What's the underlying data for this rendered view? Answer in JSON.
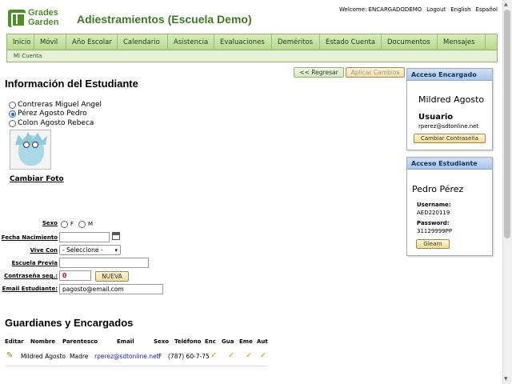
{
  "header": {
    "logo_line1": "Grades",
    "logo_line2": "Garden",
    "title": "Adiestramientos (Escuela Demo)",
    "welcome": "Welcome: ENCARGADODEMO",
    "logout": "Logout",
    "english": "English",
    "espanol": "Español"
  },
  "nav": {
    "items": [
      "Inicio",
      "Móvil",
      "Año Escolar",
      "Calendario",
      "Asistencia",
      "Evaluaciones",
      "Deméritos",
      "Estado Cuenta",
      "Documentos",
      "Mensajes"
    ],
    "sub": "Mi Cuenta"
  },
  "main": {
    "section_title": "Información del Estudiante",
    "back_button": "<< Regresar",
    "apply_button": "Aplicar Cambios",
    "students": [
      {
        "name": "Contreras Miguel Angel",
        "selected": false
      },
      {
        "name": "Pérez Agosto Pedro",
        "selected": true
      },
      {
        "name": "Colon Agosto Rebeca",
        "selected": false
      }
    ],
    "change_photo": "Cambiar Foto"
  },
  "form": {
    "sexo_label": "Sexo",
    "sexo_f": "F",
    "sexo_m": "M",
    "fecha_label": "Fecha Nacimiento",
    "fecha_value": "",
    "vive_label": "Vive Con",
    "vive_value": "- Seleccione -",
    "escuela_label": "Escuela Previa",
    "escuela_value": "",
    "pass_label": "Contraseña seg.:",
    "pass_value": "0",
    "pass_button": "NUEVA",
    "email_label": "Email Estudiante:",
    "email_value": "pagosto@email.com"
  },
  "guardians": {
    "title": "Guardianes y Encargados",
    "headers": [
      "Editar",
      "Nombre",
      "Parentesco",
      "Email",
      "Sexo",
      "Teléfono",
      "Enc",
      "Gua",
      "Eme",
      "Aut"
    ],
    "row": {
      "name": "Mildred Agosto",
      "relation": "Madre",
      "email": "rperez@sdtonline.net",
      "sex": "F",
      "phone": "(787) 60-7-75"
    }
  },
  "panel_guardian": {
    "title": "Acceso Encargado",
    "name": "Mildred Agosto",
    "user_label": "Usuario",
    "user_value": "rperez@sdtonline.net",
    "button": "Cambiar Contraseña"
  },
  "panel_student": {
    "title": "Acceso Estudiante",
    "name": "Pedro Pérez",
    "username_label": "Username:",
    "username_value": "AED220119",
    "password_label": "Password:",
    "password_value": "31129999PP",
    "button": "Glearn"
  },
  "colors": {
    "brand_green": "#3c7b22",
    "nav_green": "#b7d88e",
    "panel_blue": "#a9c6ea",
    "check_gold": "#d49b00",
    "link_blue": "#1a1acc",
    "pass_red": "#d00000"
  }
}
